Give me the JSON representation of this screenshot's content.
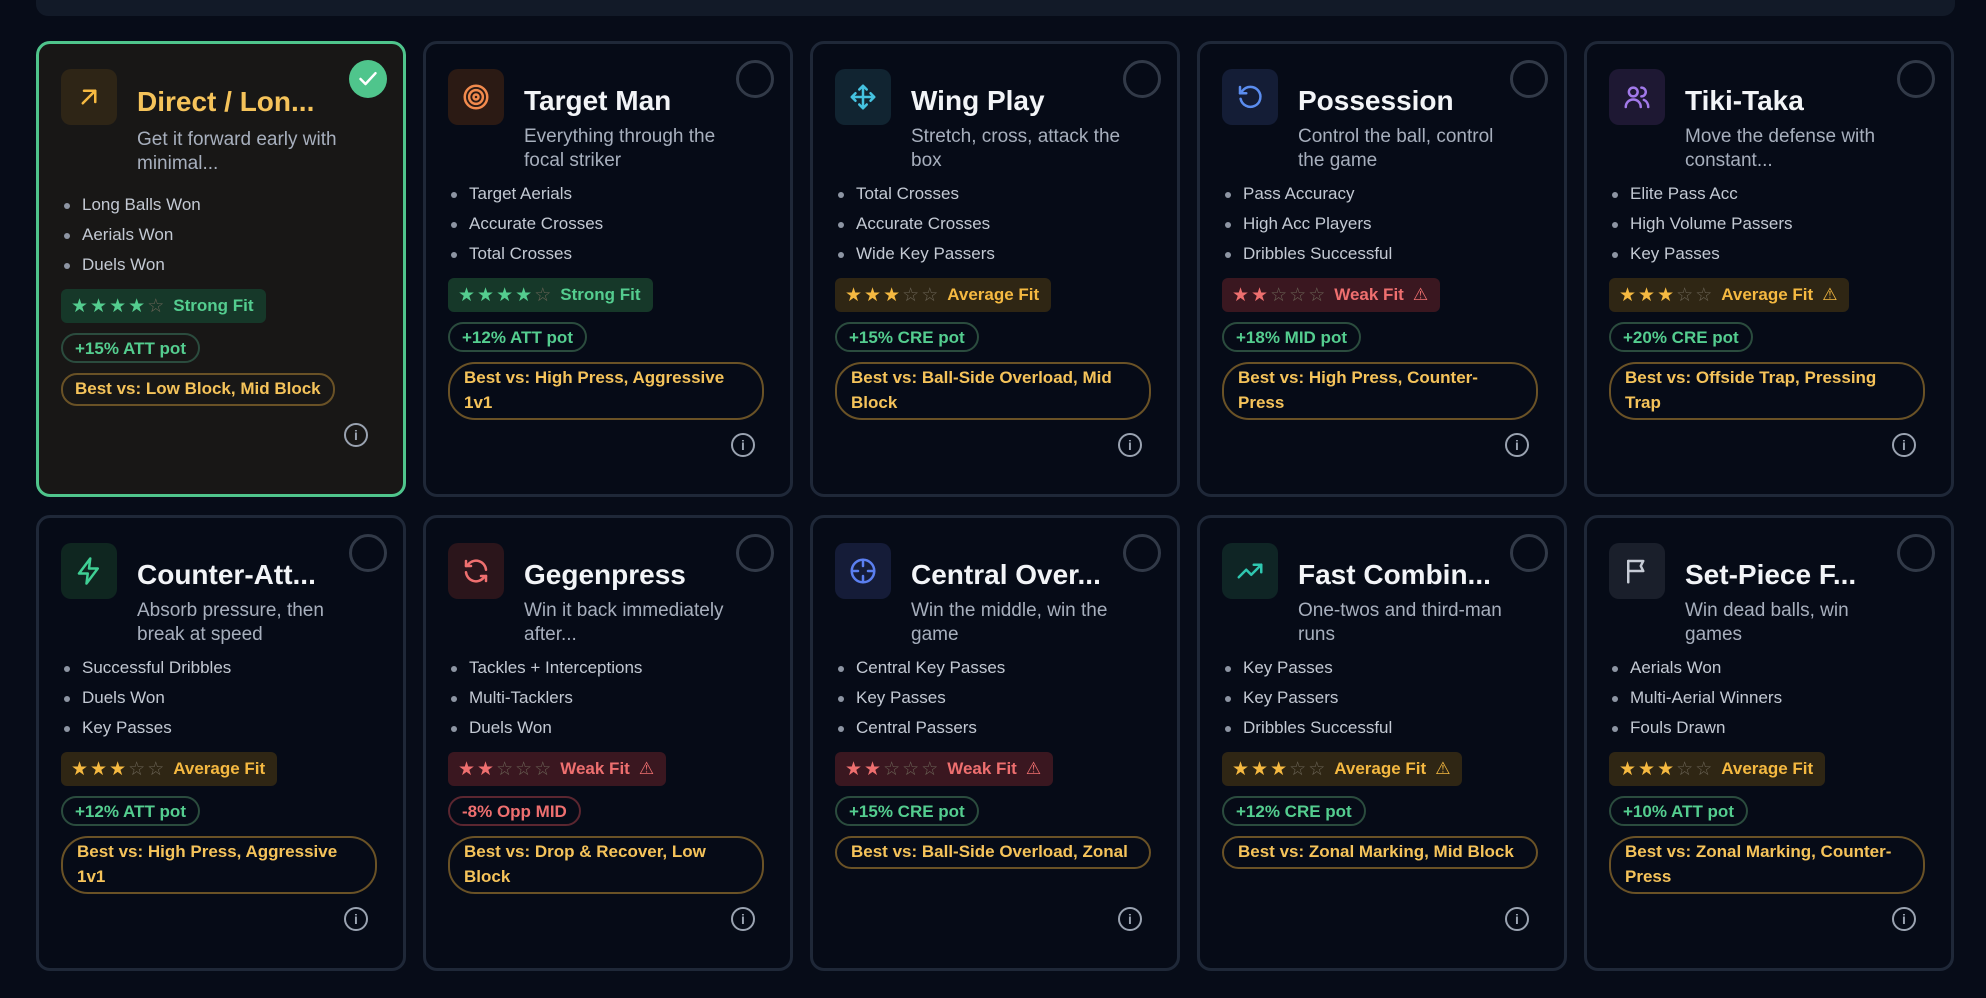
{
  "labels": {
    "best_prefix": "Best vs: ",
    "info_glyph": "i"
  },
  "colors": {
    "selected_border": "#4fc58c",
    "strong": "#54cd8f",
    "average": "#f5b941",
    "weak": "#ee6f6f",
    "best_vs": "#f5c35a"
  },
  "tactics": [
    {
      "title": "Direct / Lon...",
      "description": "Get it forward early with minimal...",
      "icon": "arrow-up-right-icon",
      "icon_color": "#f5b941",
      "icon_bg": "#2e2516",
      "selected": true,
      "bullets": [
        "Long Balls Won",
        "Aerials Won",
        "Duels Won"
      ],
      "rating": 4,
      "fit": "Strong Fit",
      "fit_level": "strong",
      "warning": false,
      "pot": "+15% ATT pot",
      "best_vs": "Low Block, Mid Block"
    },
    {
      "title": "Target Man",
      "description": "Everything through the focal striker",
      "icon": "target-icon",
      "icon_color": "#f28a4d",
      "icon_bg": "#2b1a14",
      "selected": false,
      "bullets": [
        "Target Aerials",
        "Accurate Crosses",
        "Total Crosses"
      ],
      "rating": 4,
      "fit": "Strong Fit",
      "fit_level": "strong",
      "warning": false,
      "pot": "+12% ATT pot",
      "best_vs": "High Press, Aggressive 1v1"
    },
    {
      "title": "Wing Play",
      "description": "Stretch, cross, attack the box",
      "icon": "move-arrows-icon",
      "icon_color": "#45c2e0",
      "icon_bg": "#112431",
      "selected": false,
      "bullets": [
        "Total Crosses",
        "Accurate Crosses",
        "Wide Key Passers"
      ],
      "rating": 3,
      "fit": "Average Fit",
      "fit_level": "average",
      "warning": false,
      "pot": "+15% CRE pot",
      "best_vs": "Ball-Side Overload, Mid Block"
    },
    {
      "title": "Possession",
      "description": "Control the ball, control the game",
      "icon": "rotate-ccw-icon",
      "icon_color": "#5b8def",
      "icon_bg": "#141d36",
      "selected": false,
      "bullets": [
        "Pass Accuracy",
        "High Acc Players",
        "Dribbles Successful"
      ],
      "rating": 2,
      "fit": "Weak Fit",
      "fit_level": "weak",
      "warning": true,
      "pot": "+18% MID pot",
      "best_vs": "High Press, Counter-Press"
    },
    {
      "title": "Tiki-Taka",
      "description": "Move the defense with constant...",
      "icon": "users-icon",
      "icon_color": "#a279ea",
      "icon_bg": "#1e1833",
      "selected": false,
      "bullets": [
        "Elite Pass Acc",
        "High Volume Passers",
        "Key Passes"
      ],
      "rating": 3,
      "fit": "Average Fit",
      "fit_level": "average",
      "warning": true,
      "pot": "+20% CRE pot",
      "best_vs": "Offside Trap, Pressing Trap"
    },
    {
      "title": "Counter-Att...",
      "description": "Absorb pressure, then break at speed",
      "icon": "lightning-icon",
      "icon_color": "#3fcf94",
      "icon_bg": "#0f2620",
      "selected": false,
      "bullets": [
        "Successful Dribbles",
        "Duels Won",
        "Key Passes"
      ],
      "rating": 3,
      "fit": "Average Fit",
      "fit_level": "average",
      "warning": false,
      "pot": "+12% ATT pot",
      "best_vs": "High Press, Aggressive 1v1"
    },
    {
      "title": "Gegenpress",
      "description": "Win it back immediately after...",
      "icon": "refresh-icon",
      "icon_color": "#ee6f6f",
      "icon_bg": "#2b151b",
      "selected": false,
      "bullets": [
        "Tackles + Interceptions",
        "Multi-Tacklers",
        "Duels Won"
      ],
      "rating": 2,
      "fit": "Weak Fit",
      "fit_level": "weak",
      "warning": true,
      "pot": "-8% Opp MID",
      "pot_negative": true,
      "best_vs": "Drop & Recover, Low Block"
    },
    {
      "title": "Central Over...",
      "description": "Win the middle, win the game",
      "icon": "crosshair-icon",
      "icon_color": "#5b7ff0",
      "icon_bg": "#151c38",
      "selected": false,
      "bullets": [
        "Central Key Passes",
        "Key Passes",
        "Central Passers"
      ],
      "rating": 2,
      "fit": "Weak Fit",
      "fit_level": "weak",
      "warning": true,
      "pot": "+15% CRE pot",
      "best_vs": "Ball-Side Overload, Zonal"
    },
    {
      "title": "Fast Combin...",
      "description": "One-twos and third-man runs",
      "icon": "trending-up-icon",
      "icon_color": "#2fc7b0",
      "icon_bg": "#0f2525",
      "selected": false,
      "bullets": [
        "Key Passes",
        "Key Passers",
        "Dribbles Successful"
      ],
      "rating": 3,
      "fit": "Average Fit",
      "fit_level": "average",
      "warning": true,
      "pot": "+12% CRE pot",
      "best_vs": "Zonal Marking, Mid Block"
    },
    {
      "title": "Set-Piece F...",
      "description": "Win dead balls, win games",
      "icon": "flag-icon",
      "icon_color": "#c7ccd6",
      "icon_bg": "#1a1f2b",
      "selected": false,
      "bullets": [
        "Aerials Won",
        "Multi-Aerial Winners",
        "Fouls Drawn"
      ],
      "rating": 3,
      "fit": "Average Fit",
      "fit_level": "average",
      "warning": false,
      "pot": "+10% ATT pot",
      "best_vs": "Zonal Marking, Counter-Press"
    }
  ]
}
